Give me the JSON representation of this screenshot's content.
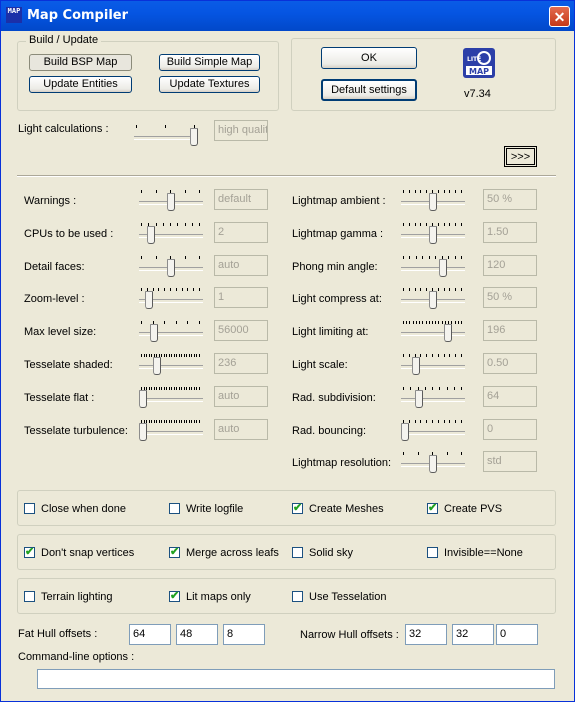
{
  "window": {
    "title": "Map Compiler",
    "icon_text": "MAP",
    "close_glyph": "✕"
  },
  "build_group": {
    "legend": "Build / Update",
    "buttons": [
      "Build BSP Map",
      "Build Simple Map",
      "Update Entities",
      "Update Textures"
    ]
  },
  "actions": {
    "ok": "OK",
    "default_settings": "Default settings",
    "version": "v7.34",
    "logo_top": "LITE",
    "logo_bottom": "MAP"
  },
  "light_calc": {
    "label": "Light calculations :",
    "value": "high qualit",
    "level": 1.0,
    "more_button": ">>>"
  },
  "left_params": [
    {
      "label": "Warnings :",
      "value": "default",
      "level": 0.5,
      "ticks": 5
    },
    {
      "label": "CPUs to be used :",
      "value": "2",
      "level": 0.15,
      "ticks": 9
    },
    {
      "label": "Detail faces:",
      "value": "auto",
      "level": 0.5,
      "ticks": 5
    },
    {
      "label": "Zoom-level :",
      "value": "1",
      "level": 0.1,
      "ticks": 11
    },
    {
      "label": "Max level size:",
      "value": "56000",
      "level": 0.2,
      "ticks": 6
    },
    {
      "label": "Tesselate shaded:",
      "value": "236",
      "level": 0.25,
      "ticks": 24
    },
    {
      "label": "Tesselate flat :",
      "value": "auto",
      "level": 0.0,
      "ticks": 24
    },
    {
      "label": "Tesselate turbulence:",
      "value": "auto",
      "level": 0.0,
      "ticks": 24
    }
  ],
  "right_params": [
    {
      "label": "Lightmap ambient :",
      "value": "50 %",
      "level": 0.5,
      "ticks": 11
    },
    {
      "label": "Lightmap gamma :",
      "value": "1.50",
      "level": 0.5,
      "ticks": 11
    },
    {
      "label": "Phong min angle:",
      "value": "120",
      "level": 0.67,
      "ticks": 10
    },
    {
      "label": "Light compress at:",
      "value": "50 %",
      "level": 0.5,
      "ticks": 11
    },
    {
      "label": "Light limiting at:",
      "value": "196",
      "level": 0.77,
      "ticks": 19
    },
    {
      "label": "Light scale:",
      "value": "0.50",
      "level": 0.2,
      "ticks": 11
    },
    {
      "label": "Rad. subdivision:",
      "value": "64",
      "level": 0.25,
      "ticks": 9
    },
    {
      "label": "Rad. bouncing:",
      "value": "0",
      "level": 0.0,
      "ticks": 11
    },
    {
      "label": "Lightmap resolution:",
      "value": "std",
      "level": 0.5,
      "ticks": 5
    }
  ],
  "checks_row1": [
    {
      "label": "Close when done",
      "checked": false
    },
    {
      "label": "Write logfile",
      "checked": false
    },
    {
      "label": "Create Meshes",
      "checked": true
    },
    {
      "label": "Create PVS",
      "checked": true
    }
  ],
  "checks_row2": [
    {
      "label": "Don't snap vertices",
      "checked": true
    },
    {
      "label": "Merge across leafs",
      "checked": true
    },
    {
      "label": "Solid sky",
      "checked": false
    },
    {
      "label": "Invisible==None",
      "checked": false
    }
  ],
  "checks_row3": [
    {
      "label": "Terrain lighting",
      "checked": false
    },
    {
      "label": "Lit maps only",
      "checked": true
    },
    {
      "label": "Use Tesselation",
      "checked": false
    }
  ],
  "hull": {
    "fat_label": "Fat Hull offsets :",
    "fat_values": [
      "64",
      "48",
      "8"
    ],
    "narrow_label": "Narrow Hull offsets :",
    "narrow_values": [
      "32",
      "32",
      "0"
    ]
  },
  "command_line": {
    "label": "Command-line options :",
    "value": ""
  },
  "check_glyph": "✔"
}
